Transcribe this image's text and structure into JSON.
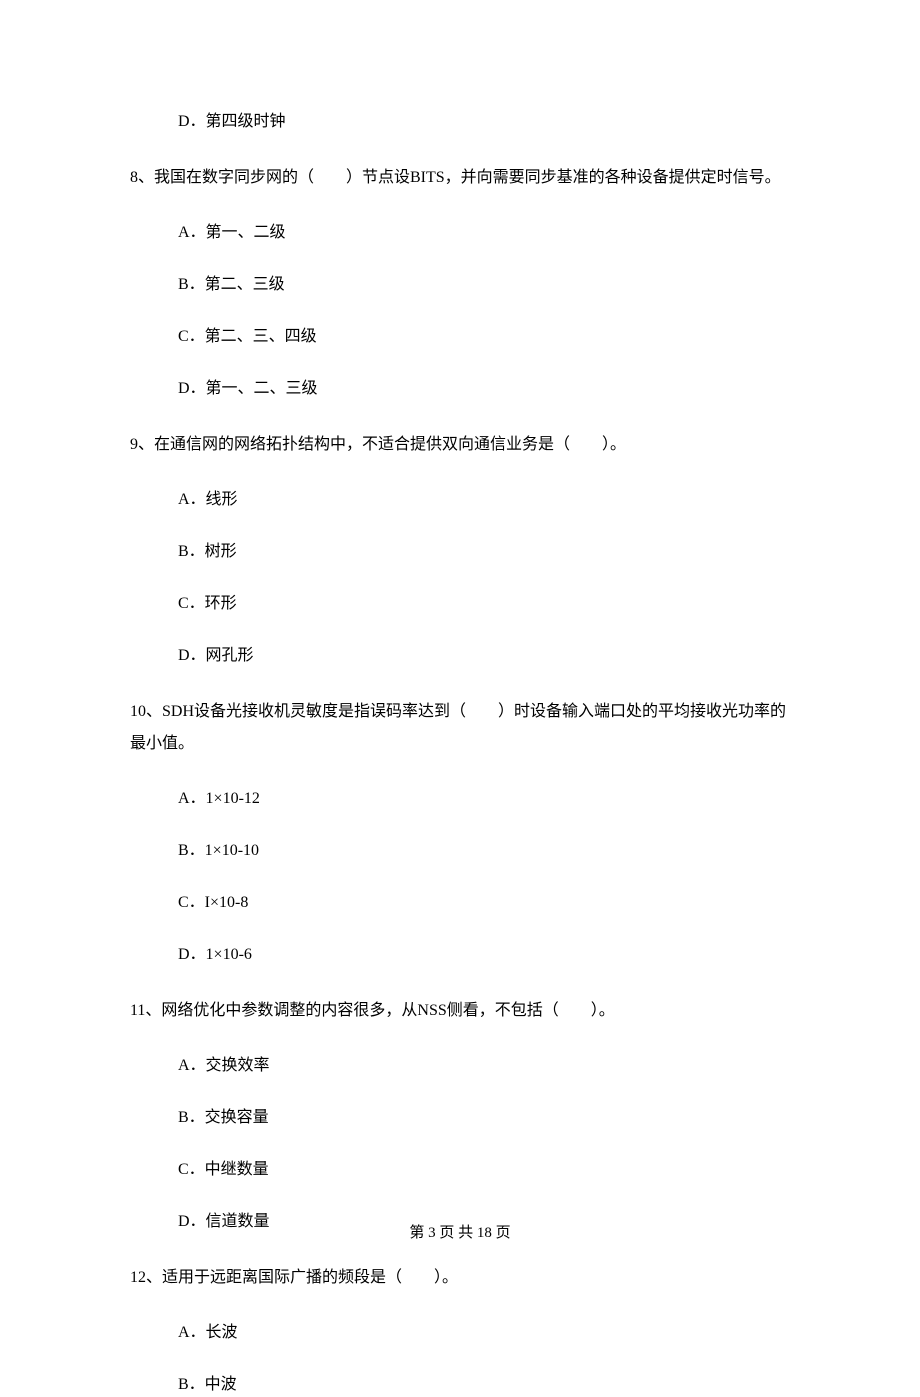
{
  "q7_optD": "D．第四级时钟",
  "q8": {
    "text": "8、我国在数字同步网的（　　）节点设BITS，并向需要同步基准的各种设备提供定时信号。",
    "options": {
      "A": "A．第一、二级",
      "B": "B．第二、三级",
      "C": "C．第二、三、四级",
      "D": "D．第一、二、三级"
    }
  },
  "q9": {
    "text": "9、在通信网的网络拓扑结构中，不适合提供双向通信业务是（　　）。",
    "options": {
      "A": "A．线形",
      "B": "B．树形",
      "C": "C．环形",
      "D": "D．网孔形"
    }
  },
  "q10": {
    "text": "10、SDH设备光接收机灵敏度是指误码率达到（　　）时设备输入端口处的平均接收光功率的最小值。",
    "options": {
      "A": "A．1×10-12",
      "B": "B．1×10-10",
      "C": "C．I×10-8",
      "D": "D．1×10-6"
    }
  },
  "q11": {
    "text": "11、网络优化中参数调整的内容很多，从NSS侧看，不包括（　　）。",
    "options": {
      "A": "A．交换效率",
      "B": "B．交换容量",
      "C": "C．中继数量",
      "D": "D．信道数量"
    }
  },
  "q12": {
    "text": "12、适用于远距离国际广播的频段是（　　）。",
    "options": {
      "A": "A．长波",
      "B": "B．中波"
    }
  },
  "footer": "第 3 页 共 18 页"
}
